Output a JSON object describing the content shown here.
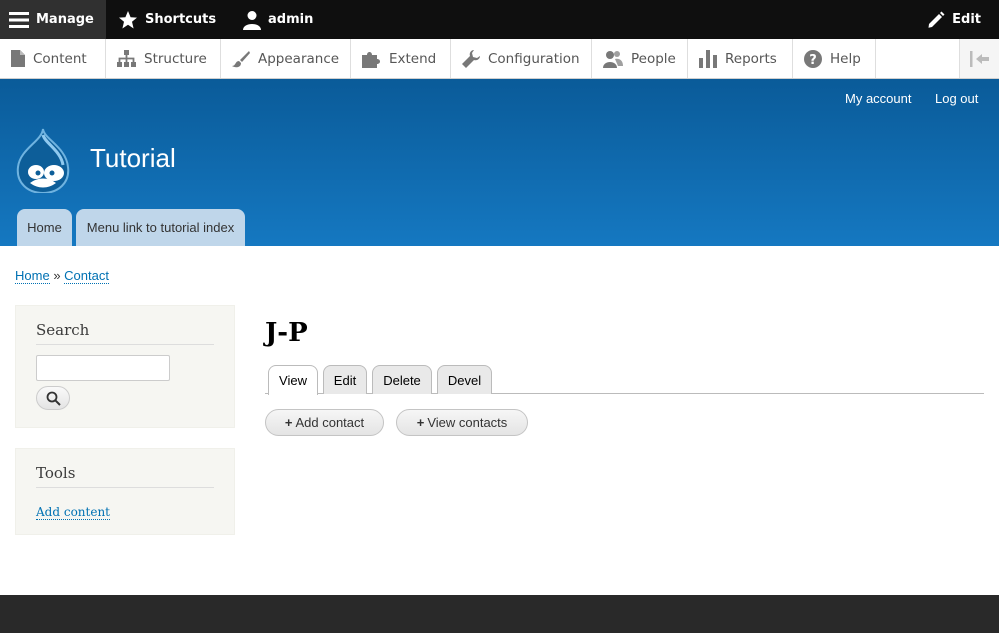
{
  "toolbar": {
    "manage": "Manage",
    "shortcuts": "Shortcuts",
    "user": "admin",
    "edit": "Edit"
  },
  "tray": {
    "items": [
      "Content",
      "Structure",
      "Appearance",
      "Extend",
      "Configuration",
      "People",
      "Reports",
      "Help"
    ]
  },
  "header": {
    "site_name": "Tutorial",
    "secondary": [
      "My account",
      "Log out"
    ],
    "primary_tabs": [
      "Home",
      "Menu link to tutorial index"
    ]
  },
  "breadcrumb": {
    "items": [
      "Home",
      "Contact"
    ],
    "separator": "»"
  },
  "sidebar": {
    "search": {
      "title": "Search",
      "value": "",
      "placeholder": ""
    },
    "tools": {
      "title": "Tools",
      "link": "Add content"
    }
  },
  "main": {
    "title": "J-P",
    "tabs": [
      "View",
      "Edit",
      "Delete",
      "Devel"
    ],
    "active_tab": "View",
    "actions": [
      "Add contact",
      "View contacts"
    ]
  },
  "colors": {
    "header_top": "#0a5b99",
    "header_bottom": "#1578c1",
    "link": "#0071b3",
    "toolbar": "#0f0f0f"
  }
}
